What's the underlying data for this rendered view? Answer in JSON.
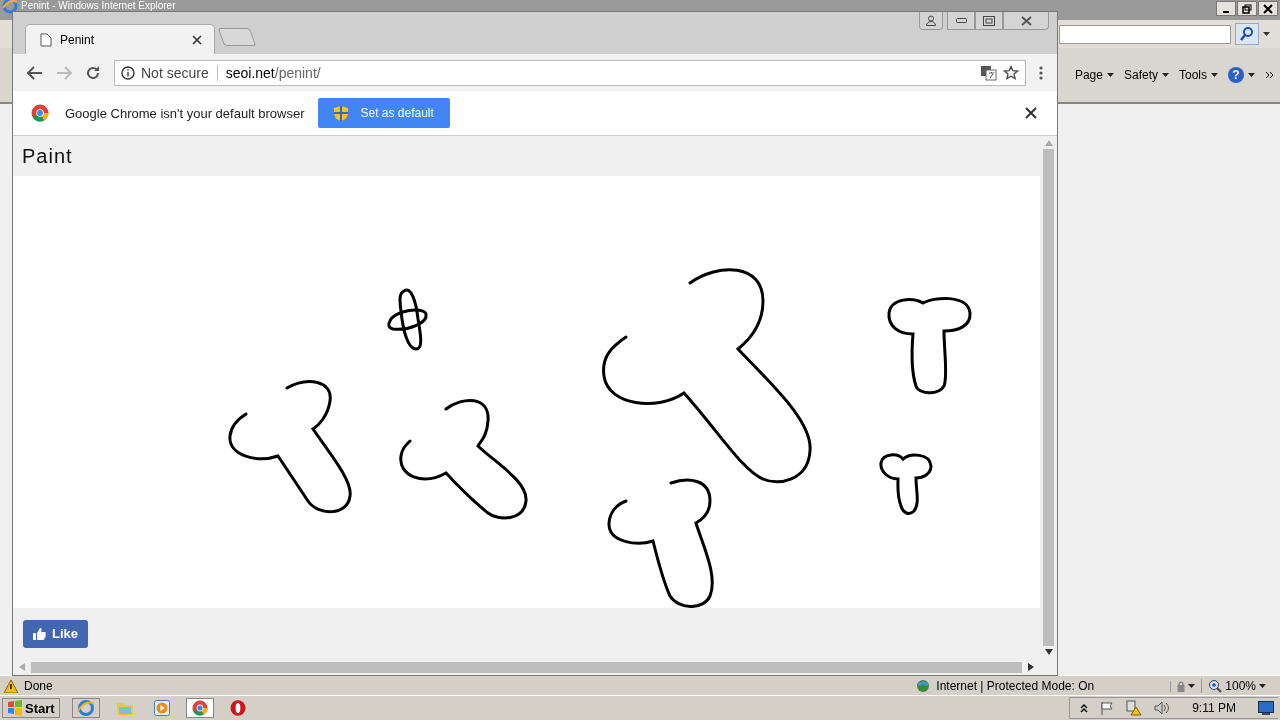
{
  "ie_window": {
    "title": "Penint - Windows Internet Explorer",
    "toolbar": [
      "Page",
      "Safety",
      "Tools"
    ],
    "help": "?",
    "status": "Done",
    "zone": "Internet | Protected Mode: On",
    "zoom": "100%"
  },
  "browser": {
    "tabs": [
      {
        "title": "Penint",
        "selected": true
      }
    ],
    "security": "Not secure",
    "url_host": "seoi.net",
    "url_path": "/penint/",
    "infobar": {
      "message": "Google Chrome isn't your default browser",
      "button": "Set as default"
    }
  },
  "page": {
    "title": "Paint",
    "like_button": "Like"
  },
  "taskbar": {
    "start": "Start",
    "clock": "9:11 PM"
  }
}
